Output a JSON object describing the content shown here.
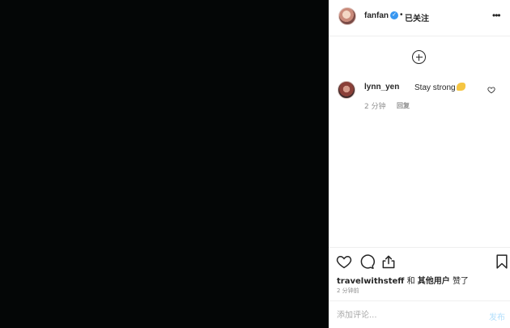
{
  "post": {
    "author": "fanfan",
    "follow_state": "已关注",
    "separator": "•"
  },
  "comments": [
    {
      "user": "lynn_yen",
      "text": "Stay strong",
      "emoji": "flexed-biceps",
      "time": "2 分钟",
      "reply_label": "回复"
    }
  ],
  "likes": {
    "first_user": "travelwithsteff",
    "connector": "和",
    "others": "其他用户",
    "suffix": "赞了"
  },
  "timestamp": "2 分钟前",
  "comment_box": {
    "placeholder": "添加评论...",
    "post_label": "发布"
  },
  "icons": [
    "more-icon",
    "load-more-icon",
    "heart-icon",
    "comment-icon",
    "share-icon",
    "bookmark-icon",
    "verified-icon"
  ],
  "colors": {
    "media_bg": "#040606",
    "verified": "#3897f0",
    "post_button": "#b2dffc",
    "muted_text": "#8e8e8e"
  }
}
